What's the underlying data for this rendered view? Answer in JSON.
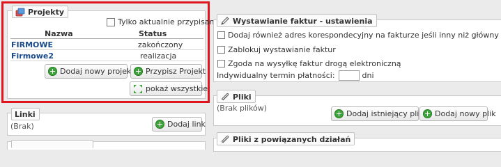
{
  "projects": {
    "title": "Projekty",
    "only_current_label": "Tylko aktualnie przypisane",
    "columns": [
      "Nazwa",
      "Status"
    ],
    "rows": [
      {
        "name": "FIRMOWE",
        "status": "zakończony"
      },
      {
        "name": "Firmowe2",
        "status": "realizacja"
      }
    ],
    "add_project_label": "Dodaj nowy projekt",
    "assign_project_label": "Przypisz Projekt",
    "show_all_label": "pokaż wszystkie"
  },
  "links": {
    "title": "Linki",
    "empty_text": "(Brak)",
    "add_label": "Dodaj link"
  },
  "invoicing": {
    "title": "Wystawianie faktur - ustawienia",
    "options": [
      "Dodaj również adres korespondecyjny na fakturze jeśli inny niż główny",
      "Zablokuj wystawianie faktur",
      "Zgoda na wysyłkę faktur drogą elektroniczną"
    ],
    "payment_term_label": "Indywidualny termin płatności:",
    "payment_term_value": "",
    "payment_term_unit": "dni"
  },
  "files": {
    "title": "Pliki",
    "empty_text": "(Brak plików)",
    "add_existing_label": "Dodaj istniejący plik",
    "add_new_label": "Dodaj nowy plik"
  },
  "related_files": {
    "title": "Pliki z powiązanych działań"
  },
  "colors": {
    "highlight_border": "#e0141c",
    "link": "#1a4a8c",
    "button_icon": "#3ea33a"
  }
}
